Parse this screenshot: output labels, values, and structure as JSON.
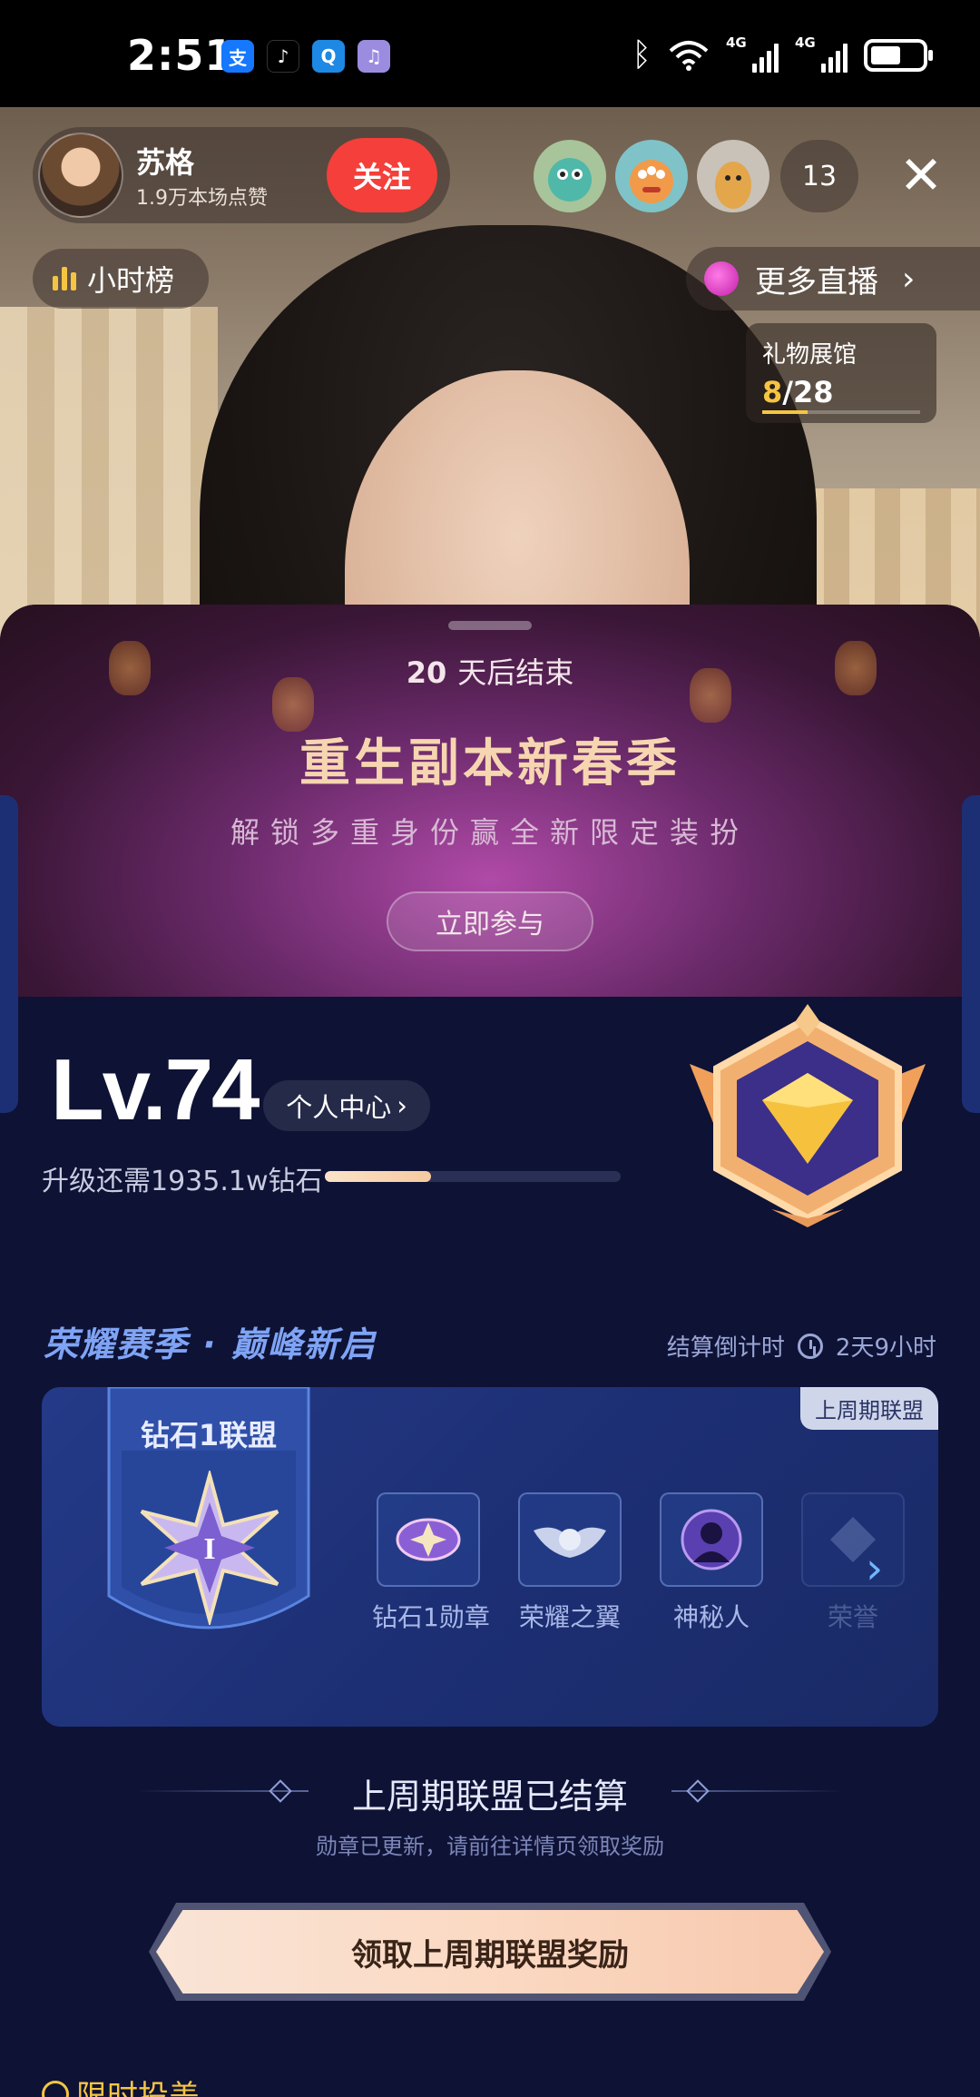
{
  "status_bar": {
    "time": "2:51",
    "apps": [
      {
        "icon": "alipay-icon",
        "glyph": "支",
        "color": "#1677ff"
      },
      {
        "icon": "tiktok-icon",
        "glyph": "♪",
        "color": "#000000"
      },
      {
        "icon": "search-app-icon",
        "glyph": "Q",
        "color": "#1e88e5"
      },
      {
        "icon": "music-app-icon",
        "glyph": "♫",
        "color": "#9c8ce0"
      }
    ],
    "network_1": "4G",
    "network_2": "4G"
  },
  "host": {
    "name": "苏格",
    "likes": "1.9万本场点赞",
    "follow_label": "关注"
  },
  "viewers": {
    "count": "13",
    "avatars": [
      "viewer-avatar-1",
      "viewer-avatar-2",
      "viewer-avatar-3"
    ]
  },
  "hour_rank_label": "小时榜",
  "more_live_label": "更多直播",
  "gift_hall": {
    "title": "礼物展馆",
    "current": "8",
    "total": "/28",
    "progress": 0.285
  },
  "banner": {
    "days_num": "20",
    "days_text": "天后结束",
    "title": "重生副本新春季",
    "subtitle": "解锁多重身份赢全新限定装扮",
    "join_label": "立即参与"
  },
  "level": {
    "lv_text": "Lv.74",
    "personal_center_label": "个人中心",
    "upgrade_text": "升级还需1935.1w钻石",
    "progress": 0.36
  },
  "season": {
    "title": "荣耀赛季 · 巅峰新启",
    "countdown_label": "结算倒计时",
    "countdown_value": "2天9小时"
  },
  "league": {
    "tag": "上周期联盟",
    "tier_name": "钻石1联盟",
    "rewards": [
      {
        "label": "钻石1勋章",
        "icon": "diamond-medal-icon"
      },
      {
        "label": "荣耀之翼",
        "icon": "glory-wing-icon"
      },
      {
        "label": "神秘人",
        "icon": "mystery-person-icon"
      },
      {
        "label": "荣誉",
        "icon": "honor-icon"
      }
    ]
  },
  "settled": {
    "title": "上周期联盟已结算",
    "subtitle": "勋章已更新，请前往详情页领取奖励",
    "claim_label": "领取上周期联盟奖励"
  },
  "limited_label": "限时投盖"
}
